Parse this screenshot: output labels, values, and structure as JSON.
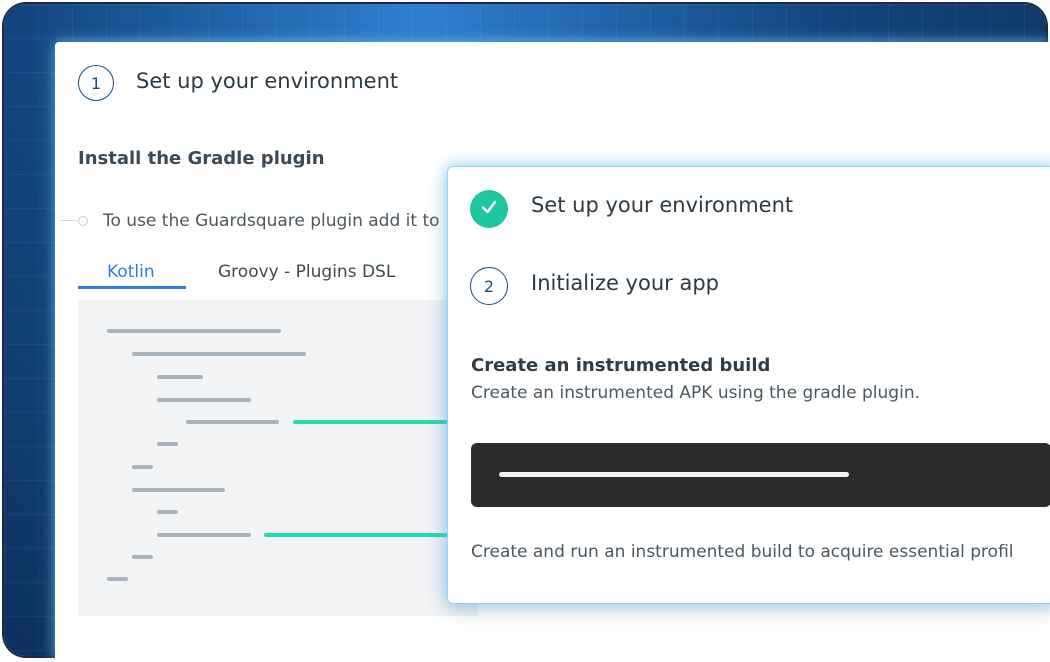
{
  "back": {
    "step_number": "1",
    "step_title": "Set up your environment",
    "section_heading": "Install the Gradle plugin",
    "instruction": "To use the Guardsquare plugin add it to",
    "tabs": [
      {
        "label": "Kotlin",
        "active": true
      },
      {
        "label": "Groovy - Plugins DSL",
        "active": false
      }
    ]
  },
  "front": {
    "steps": [
      {
        "status": "complete",
        "icon": "check-icon",
        "title": "Set up your environment"
      },
      {
        "status": "current",
        "number": "2",
        "title": "Initialize your app"
      }
    ],
    "section_heading": "Create an instrumented build",
    "section_desc": "Create an instrumented APK using the gradle plugin.",
    "footer_text": "Create and run an instrumented build to acquire essential profil"
  },
  "colors": {
    "accent_blue": "#2b7fe0",
    "success_green": "#1fc7a0",
    "code_accent": "#22dcae",
    "frame_blue": "#13467f",
    "dark_bar": "#2b2a2d"
  }
}
